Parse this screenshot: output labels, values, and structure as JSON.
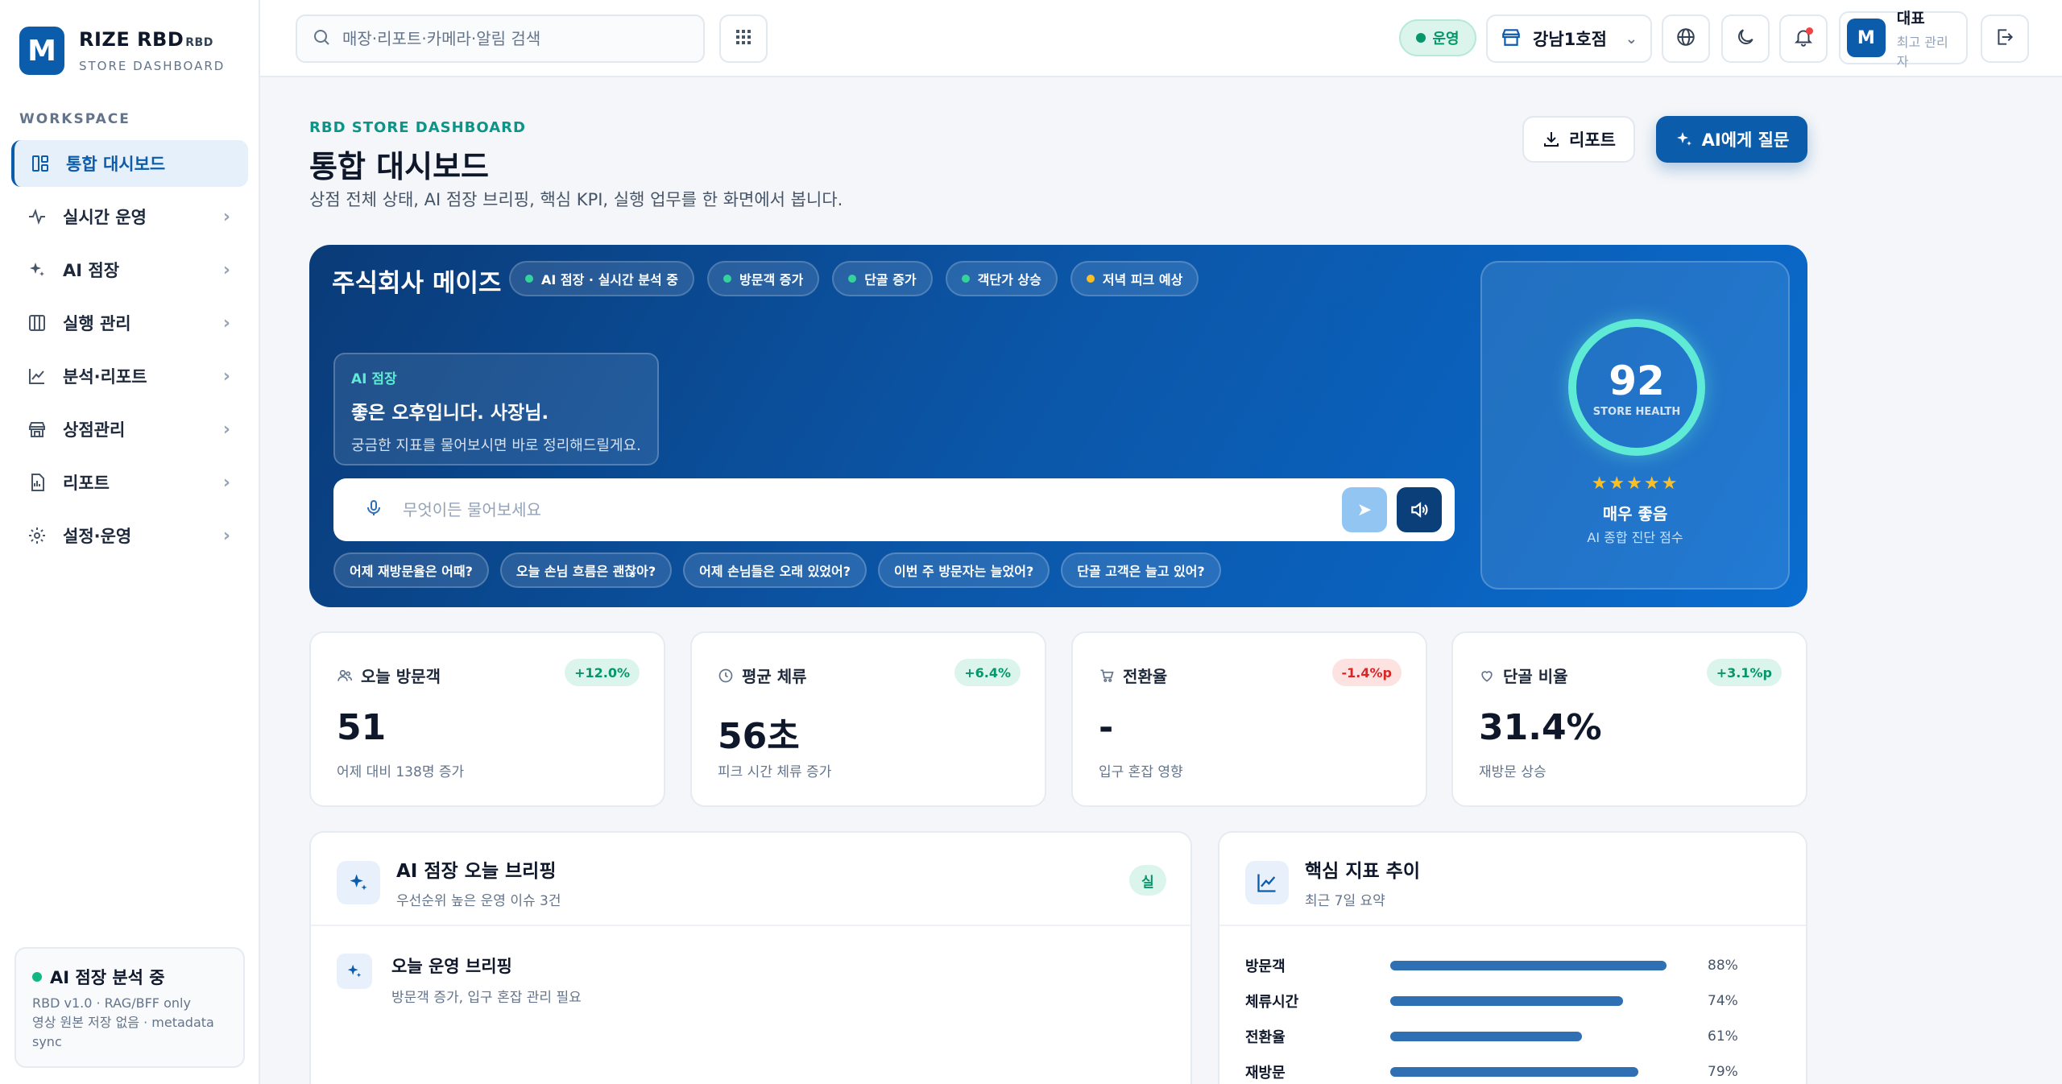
{
  "brand": {
    "title": "RIZE RBD",
    "title_suffix": "RBD",
    "subtitle": "STORE DASHBOARD",
    "logo_letter": "M"
  },
  "sidebar": {
    "section_label": "WORKSPACE",
    "items": [
      {
        "label": "통합 대시보드",
        "icon": "dashboard-icon",
        "active": true
      },
      {
        "label": "실시간 운영",
        "icon": "activity-icon"
      },
      {
        "label": "AI 점장",
        "icon": "sparkle-icon"
      },
      {
        "label": "실행 관리",
        "icon": "kanban-icon"
      },
      {
        "label": "분석·리포트",
        "icon": "chart-line-icon"
      },
      {
        "label": "상점관리",
        "icon": "store-icon"
      },
      {
        "label": "리포트",
        "icon": "file-icon"
      },
      {
        "label": "설정·운영",
        "icon": "gear-icon"
      }
    ],
    "footer": {
      "status": "AI 점장 분석 중",
      "line1": "RBD v1.0 · RAG/BFF only",
      "line2": "영상 원본 저장 없음 · metadata",
      "line3": "sync"
    }
  },
  "topbar": {
    "search_placeholder": "매장·리포트·카메라·알림 검색",
    "status": "운영",
    "store": "강남1호점",
    "user": {
      "name": "대표",
      "role": "최고 관리자",
      "initial": "M"
    }
  },
  "page": {
    "eyebrow": "RBD STORE DASHBOARD",
    "title": "통합 대시보드",
    "description": "상점 전체 상태, AI 점장 브리핑, 핵심 KPI, 실행 업무를 한 화면에서 봅니다.",
    "report_button": "리포트",
    "ai_button": "AI에게 질문"
  },
  "hero": {
    "company": "주식회사 메이즈",
    "chips": [
      {
        "label": "AI 점장 · 실시간 분석 중",
        "tone": "ok"
      },
      {
        "label": "방문객 증가",
        "tone": "ok"
      },
      {
        "label": "단골 증가",
        "tone": "ok"
      },
      {
        "label": "객단가 상승",
        "tone": "ok"
      },
      {
        "label": "저녁 피크 예상",
        "tone": "warn"
      }
    ],
    "ai_card": {
      "tag": "AI 점장",
      "greeting": "좋은 오후입니다. 사장님.",
      "sub": "궁금한 지표를 물어보시면 바로 정리해드릴게요."
    },
    "ask_placeholder": "무엇이든 물어보세요",
    "suggestions": [
      "어제 재방문율은 어때?",
      "오늘 손님 흐름은 괜찮아?",
      "어제 손님들은 오래 있었어?",
      "이번 주 방문자는 늘었어?",
      "단골 고객은 늘고 있어?"
    ],
    "health": {
      "score": "92",
      "label": "STORE HEALTH",
      "stars": "★★★★★",
      "grade": "매우 좋음",
      "grade_sub": "AI 종합 진단 점수"
    }
  },
  "kpis": [
    {
      "label": "오늘 방문객",
      "icon": "users-icon",
      "badge": "+12.0%",
      "trend": "up",
      "value": "51",
      "sub": "어제 대비 138명 증가"
    },
    {
      "label": "평균 체류",
      "icon": "clock-icon",
      "badge": "+6.4%",
      "trend": "up",
      "value": "56초",
      "sub": "피크 시간 체류 증가"
    },
    {
      "label": "전환율",
      "icon": "cart-icon",
      "badge": "-1.4%p",
      "trend": "down",
      "value": "-",
      "sub": "입구 혼잡 영향"
    },
    {
      "label": "단골 비율",
      "icon": "heart-icon",
      "badge": "+3.1%p",
      "trend": "up",
      "value": "31.4%",
      "sub": "재방문 상승"
    }
  ],
  "briefing": {
    "title": "AI 점장 오늘 브리핑",
    "subtitle": "우선순위 높은 운영 이슈 3건",
    "badge": "실",
    "items": [
      {
        "title": "오늘 운영 브리핑",
        "sub": "방문객 증가, 입구 혼잡 관리 필요"
      }
    ]
  },
  "trend": {
    "title": "핵심 지표 추이",
    "subtitle": "최근 7일 요약",
    "rows": [
      {
        "label": "방문객",
        "value": 88,
        "display": "88%"
      },
      {
        "label": "체류시간",
        "value": 74,
        "display": "74%"
      },
      {
        "label": "전환율",
        "value": 61,
        "display": "61%"
      },
      {
        "label": "재방문",
        "value": 79,
        "display": "79%"
      }
    ]
  },
  "colors": {
    "accent": "#0b5cab",
    "success": "#059669",
    "danger": "#dc2626",
    "hero_start": "#0a3b78",
    "hero_end": "#0a6ccf",
    "ring": "#5eead4"
  }
}
